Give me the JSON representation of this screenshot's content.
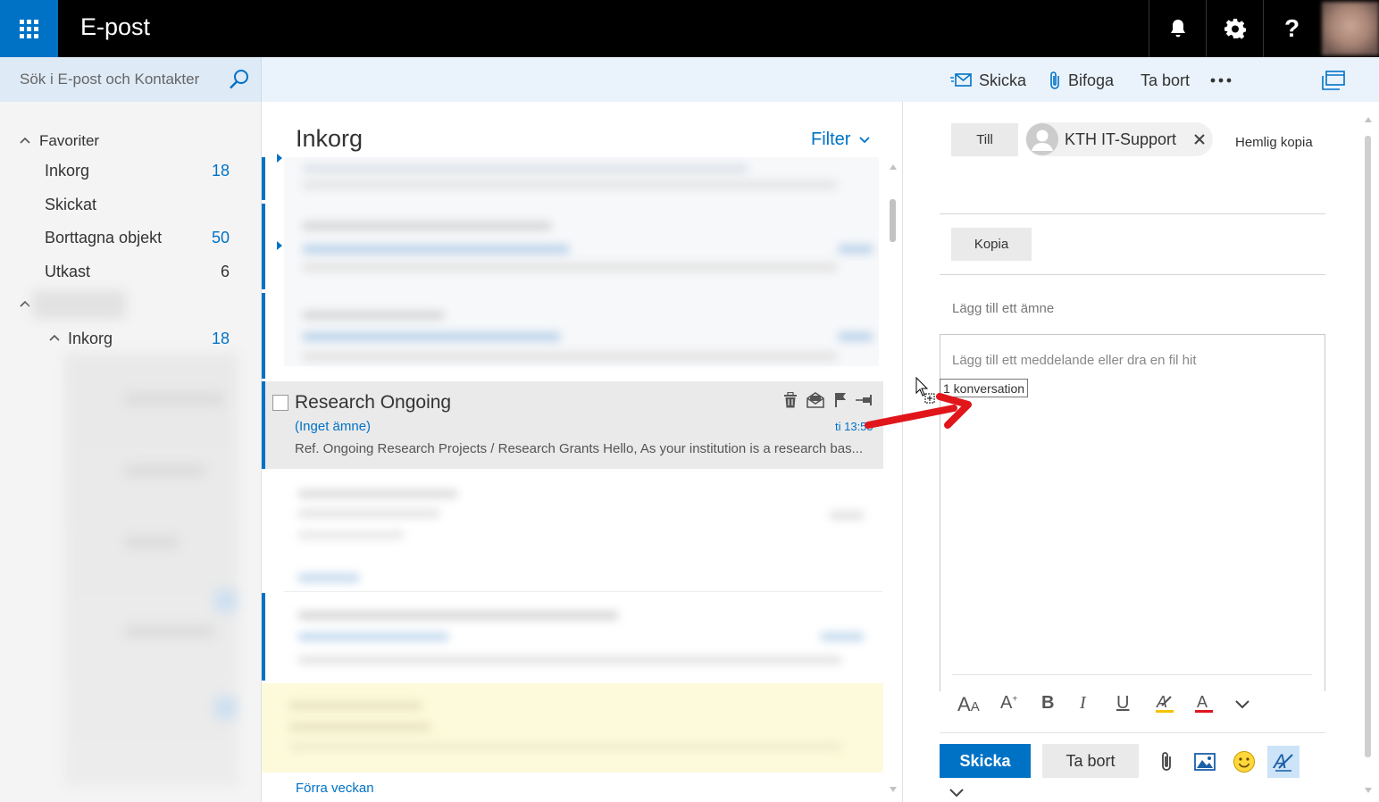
{
  "app": {
    "title": "E-post"
  },
  "search": {
    "placeholder": "Sök i E-post och Kontakter"
  },
  "toolbar": {
    "send_label": "Skicka",
    "attach_label": "Bifoga",
    "discard_label": "Ta bort"
  },
  "nav": {
    "favorites_label": "Favoriter",
    "items": [
      {
        "label": "Inkorg",
        "count": "18"
      },
      {
        "label": "Skickat",
        "count": ""
      },
      {
        "label": "Borttagna objekt",
        "count": "50"
      },
      {
        "label": "Utkast",
        "count": "6"
      }
    ],
    "account_inbox": {
      "label": "Inkorg",
      "count": "18"
    }
  },
  "list": {
    "title": "Inkorg",
    "filter_label": "Filter",
    "selected": {
      "sender": "Research Ongoing",
      "subject": "(Inget ämne)",
      "time": "ti 13:55",
      "preview": "Ref. Ongoing Research Projects / Research Grants Hello, As your institution is a research bas..."
    },
    "section_label": "Förra veckan"
  },
  "compose": {
    "to_label": "Till",
    "recipient": "KTH IT-Support",
    "bcc_label": "Hemlig kopia",
    "cc_label": "Kopia",
    "subject_placeholder": "Lägg till ett ämne",
    "body_placeholder": "Lägg till ett meddelande eller dra en fil hit",
    "drag_tooltip": "1 konversation",
    "send_label": "Skicka",
    "discard_label": "Ta bort"
  },
  "colors": {
    "accent": "#0072c6",
    "topbar": "#000000",
    "arrow": "#e0161b"
  }
}
